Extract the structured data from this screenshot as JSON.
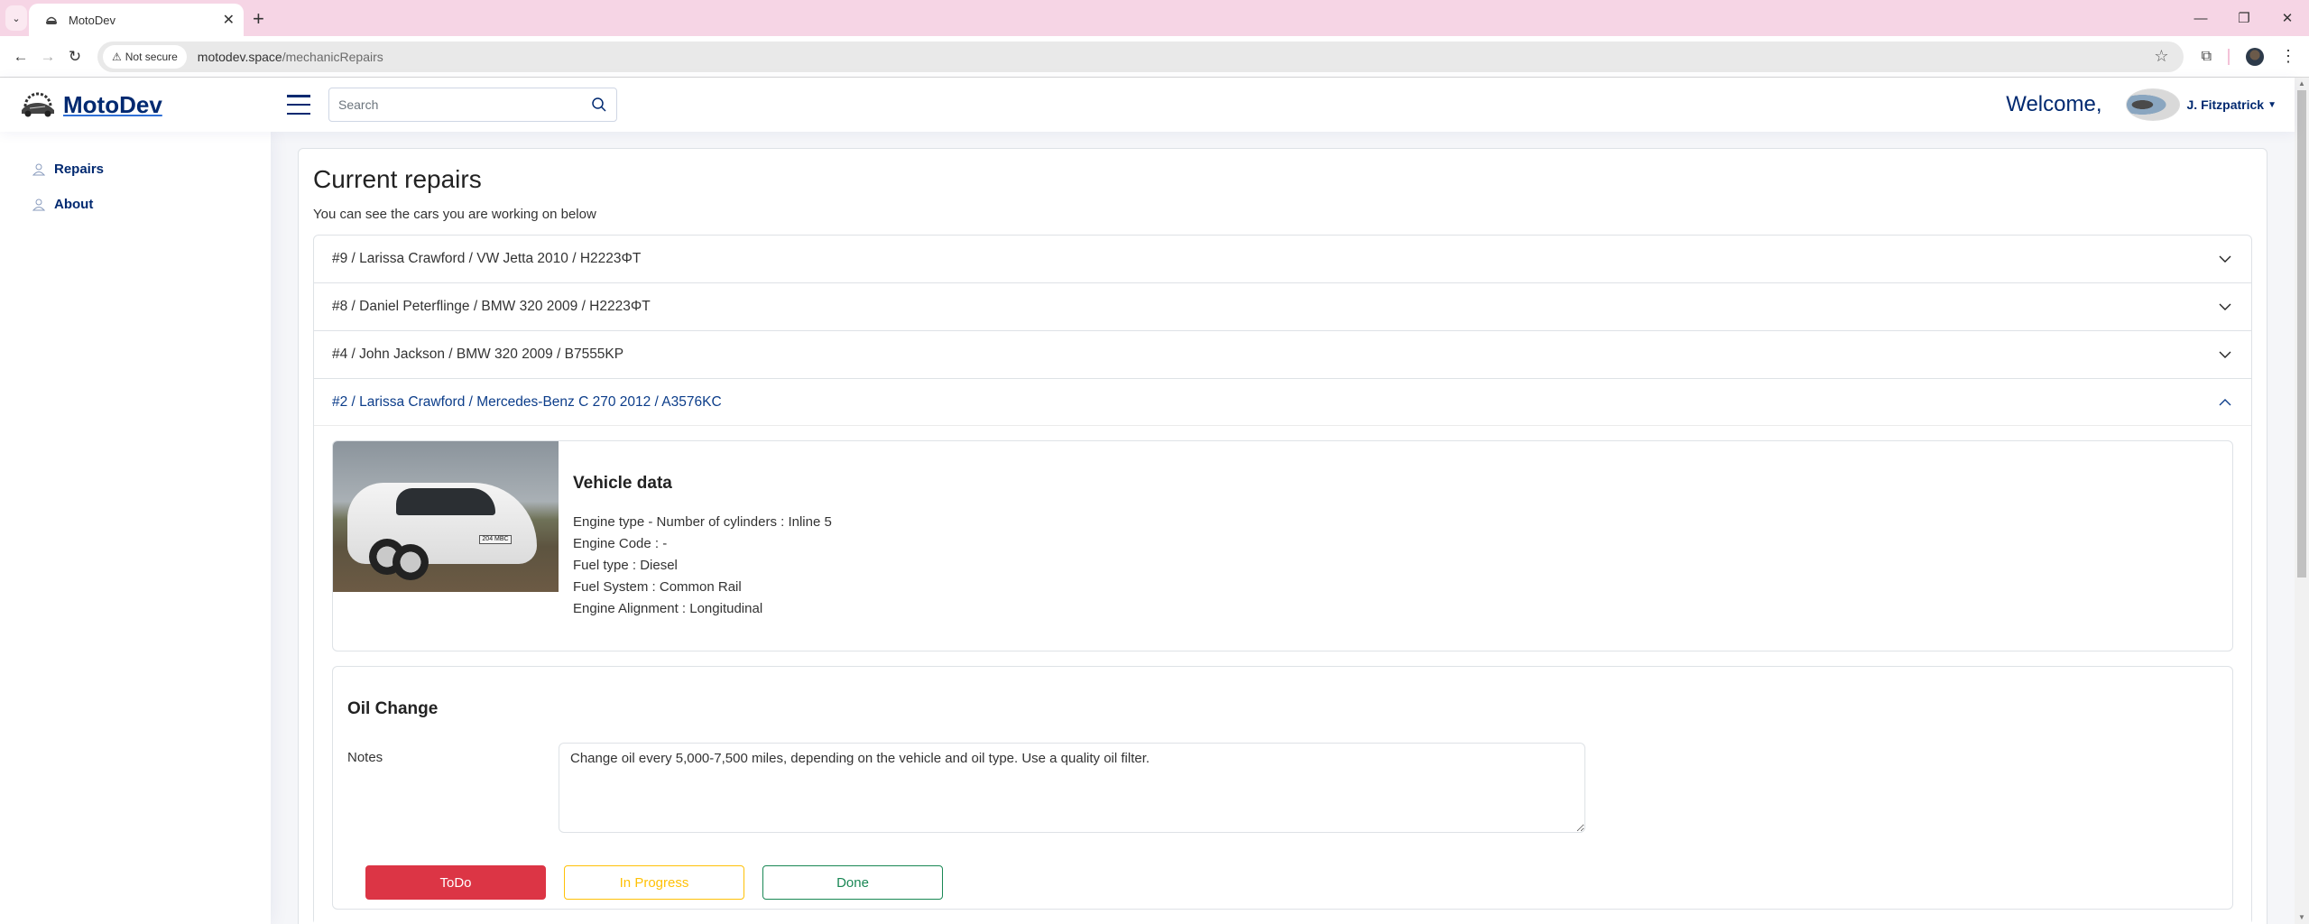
{
  "browser": {
    "tab_title": "MotoDev",
    "security_label": "Not secure",
    "url_domain": "motodev.space",
    "url_path": "/mechanicRepairs"
  },
  "header": {
    "brand": "MotoDev",
    "search_placeholder": "Search",
    "welcome": "Welcome,",
    "user_name": "J. Fitzpatrick"
  },
  "sidebar": {
    "items": [
      {
        "label": "Repairs",
        "icon": "person-icon"
      },
      {
        "label": "About",
        "icon": "person-icon"
      }
    ]
  },
  "main": {
    "title": "Current repairs",
    "subtitle": "You can see the cars you are working on below",
    "repairs": [
      {
        "label": "#9 / Larissa Crawford / VW Jetta 2010 / H2223ΦT",
        "expanded": false
      },
      {
        "label": "#8 / Daniel Peterflinge / BMW 320 2009 / H2223ΦT",
        "expanded": false
      },
      {
        "label": "#4 / John Jackson / BMW 320 2009 / B7555KP",
        "expanded": false
      },
      {
        "label": "#2 / Larissa Crawford / Mercedes-Benz C 270 2012 / A3576KC",
        "expanded": true
      }
    ],
    "vehicle": {
      "heading": "Vehicle data",
      "plate_on_image": "204 MBC",
      "rows": [
        "Engine type - Number of cylinders : Inline 5",
        "Engine Code : -",
        "Fuel type : Diesel",
        "Fuel System : Common Rail",
        "Engine Alignment : Longitudinal"
      ]
    },
    "task": {
      "title": "Oil Change",
      "notes_label": "Notes",
      "notes_value": "Change oil every 5,000-7,500 miles, depending on the vehicle and oil type. Use a quality oil filter.",
      "buttons": {
        "todo": "ToDo",
        "in_progress": "In Progress",
        "done": "Done"
      },
      "active_status": "ToDo"
    }
  },
  "colors": {
    "brand": "#012970",
    "todo": "#dc3545",
    "in_progress": "#ffc107",
    "done": "#198754"
  }
}
